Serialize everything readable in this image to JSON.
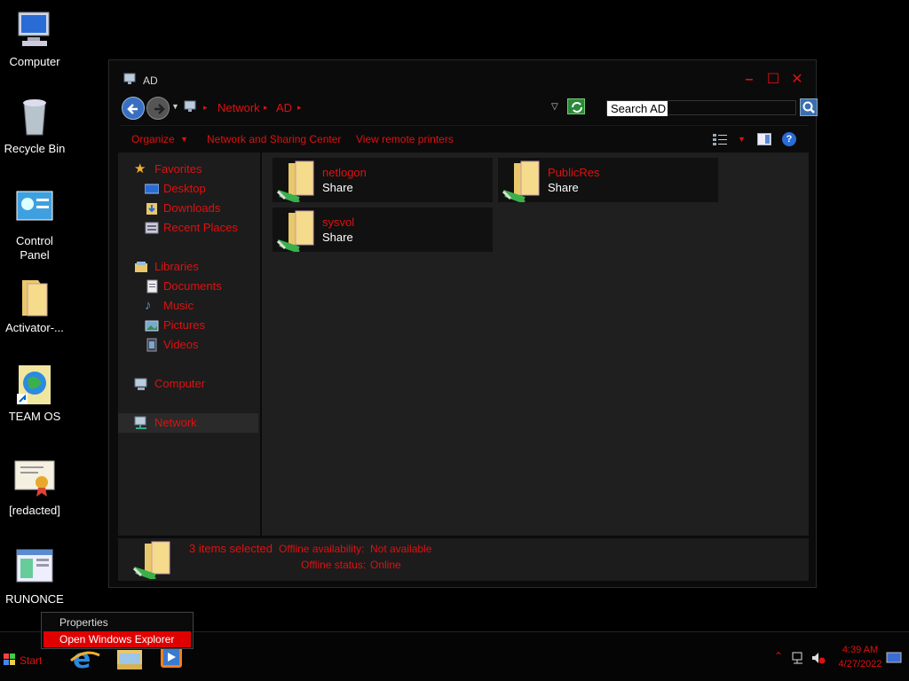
{
  "desktop": {
    "icons": [
      {
        "label": "Computer",
        "icon": "computer-icon"
      },
      {
        "label": "Recycle Bin",
        "icon": "recycle-bin-icon"
      },
      {
        "label": "Control Panel",
        "icon": "control-panel-icon"
      },
      {
        "label": "Activator-...",
        "icon": "folder-icon"
      },
      {
        "label": "TEAM OS",
        "icon": "globe-shortcut-icon"
      },
      {
        "label": "[redacted]",
        "icon": "certificate-icon"
      },
      {
        "label": "RUNONCE",
        "icon": "window-app-icon"
      }
    ]
  },
  "window": {
    "title": "AD",
    "breadcrumb": [
      "Network",
      "AD"
    ],
    "search_placeholder": "Search AD",
    "toolbar": {
      "organize": "Organize",
      "network_sharing": "Network and Sharing Center",
      "view_printers": "View remote printers"
    },
    "nav": {
      "favorites": "Favorites",
      "desktop": "Desktop",
      "downloads": "Downloads",
      "recent": "Recent Places",
      "libraries": "Libraries",
      "documents": "Documents",
      "music": "Music",
      "pictures": "Pictures",
      "videos": "Videos",
      "computer": "Computer",
      "network": "Network"
    },
    "items": [
      {
        "name": "netlogon",
        "type": "Share"
      },
      {
        "name": "PublicRes",
        "type": "Share"
      },
      {
        "name": "sysvol",
        "type": "Share"
      }
    ],
    "details": {
      "selected": "3 items selected",
      "offline_avail_label": "Offline availability:",
      "offline_avail_value": "Not available",
      "offline_status_label": "Offline status:",
      "offline_status_value": "Online"
    }
  },
  "context_menu": {
    "items": [
      "Properties",
      "Open Windows Explorer"
    ]
  },
  "taskbar": {
    "start": "Start",
    "time": "4:39 AM",
    "date": "4/27/2022"
  },
  "colors": {
    "accent": "#e01010",
    "background": "#000000",
    "pane": "#1c1c1c"
  }
}
